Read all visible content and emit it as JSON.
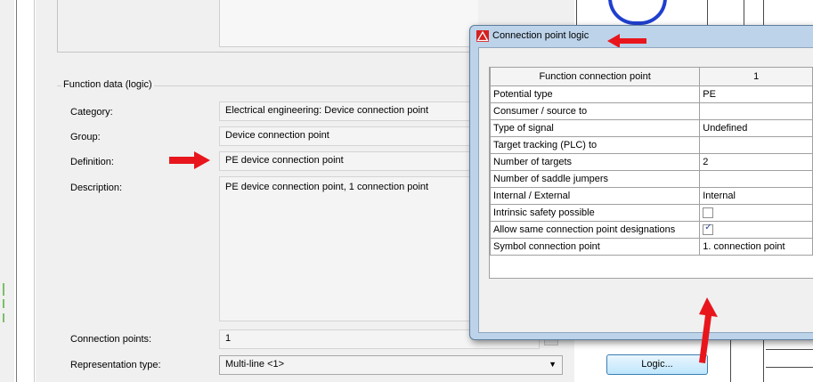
{
  "form": {
    "group_title": "Function data (logic)",
    "fields": [
      {
        "label": "Category:",
        "value": "Electrical engineering: Device connection point"
      },
      {
        "label": "Group:",
        "value": "Device connection point"
      },
      {
        "label": "Definition:",
        "value": "PE device connection point"
      },
      {
        "label": "Description:",
        "value": "PE device connection point, 1 connection point"
      }
    ],
    "connection_points_label": "Connection points:",
    "connection_points_value": "1",
    "representation_label": "Representation type:",
    "representation_value": "Multi-line <1>",
    "logic_button": "Logic..."
  },
  "popup": {
    "title": "Connection point logic",
    "header": {
      "col1": "Function connection point",
      "col2": "1"
    },
    "rows": [
      {
        "label": "Potential type",
        "value": "PE"
      },
      {
        "label": "Consumer / source to",
        "value": ""
      },
      {
        "label": "Type of signal",
        "value": "Undefined"
      },
      {
        "label": "Target tracking (PLC) to",
        "value": ""
      },
      {
        "label": "Number of targets",
        "value": "2"
      },
      {
        "label": "Number of saddle jumpers",
        "value": ""
      },
      {
        "label": "Internal / External",
        "value": "Internal"
      },
      {
        "label": "Intrinsic safety possible",
        "checked": false
      },
      {
        "label": "Allow same connection point designations",
        "checked": true
      },
      {
        "label": "Symbol connection point",
        "value": "1. connection point"
      }
    ]
  },
  "colors": {
    "annotation_arrow": "#e8161c",
    "logic_button_border": "#3c7fb1",
    "popup_frame": "#bcd3ea"
  }
}
